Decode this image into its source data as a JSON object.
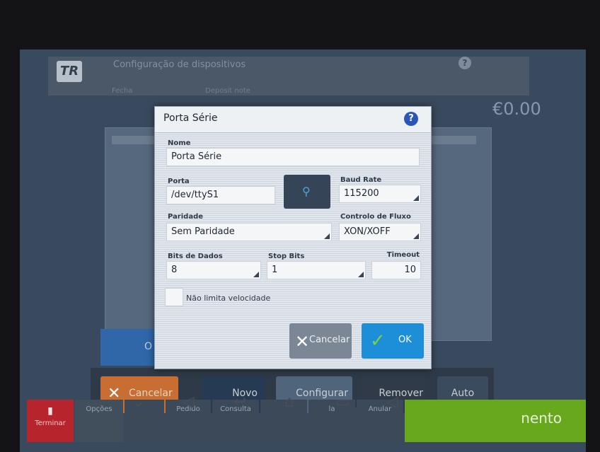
{
  "background": {
    "window_title": "Configuração de dispositivos",
    "sub_left": "Fecha",
    "sub_right": "Deposit note",
    "help_icon": "?",
    "logo": "TR",
    "total": "€0.00",
    "ok_label": "O",
    "buttons": {
      "cancel": "Cancelar",
      "novo": "Novo",
      "configurar": "Configurar",
      "remover": "Remover",
      "auto": "Auto"
    },
    "bottom_bar": {
      "terminar": "Terminar",
      "opcoes": "Opções",
      "pedido": "Pedido",
      "consulta": "Consulta",
      "item7": "la",
      "anular": "Anular",
      "pagamento": "nento"
    }
  },
  "dialog": {
    "title": "Porta Série",
    "help_icon": "?",
    "fields": {
      "nome_label": "Nome",
      "nome_value": "Porta Série",
      "porta_label": "Porta",
      "porta_value": "/dev/ttyS1",
      "baud_label": "Baud Rate",
      "baud_value": "115200",
      "paridade_label": "Paridade",
      "paridade_value": "Sem Paridade",
      "fluxo_label": "Controlo de Fluxo",
      "fluxo_value": "XON/XOFF",
      "bits_label": "Bits de Dados",
      "bits_value": "8",
      "stop_label": "Stop Bits",
      "stop_value": "1",
      "timeout_label": "Timeout",
      "timeout_value": "10"
    },
    "checkbox_label": "Não limita velocidade",
    "checkbox_checked": false,
    "cancel_label": "Cancelar",
    "ok_label": "OK"
  },
  "colors": {
    "accent_blue": "#1d8fd8",
    "cancel_orange": "#c86e33",
    "terminar_red": "#b8242c",
    "pagamento_green": "#68a81c"
  }
}
